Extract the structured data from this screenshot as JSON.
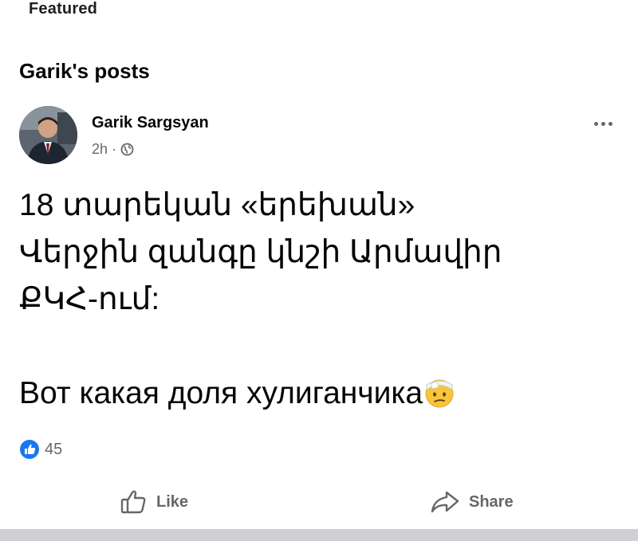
{
  "header": {
    "featured_label": "Featured",
    "section_title": "Garik's posts"
  },
  "post": {
    "author": "Garik Sargsyan",
    "time": "2h",
    "separator": "·",
    "audience_icon": "globe-icon",
    "lines": [
      "18 տարեկան «երեխան»",
      "Վերջին զանգը կնշի Արմավիր",
      "ՔԿՀ-ում:",
      "",
      "Вот какая доля хулиганчика"
    ],
    "emoji": "face-with-head-bandage-emoji",
    "reaction_count": "45"
  },
  "actions": {
    "like_label": "Like",
    "share_label": "Share"
  },
  "colors": {
    "accent": "#1877f2",
    "secondary_text": "#65676b",
    "divider": "#ced0d4"
  }
}
